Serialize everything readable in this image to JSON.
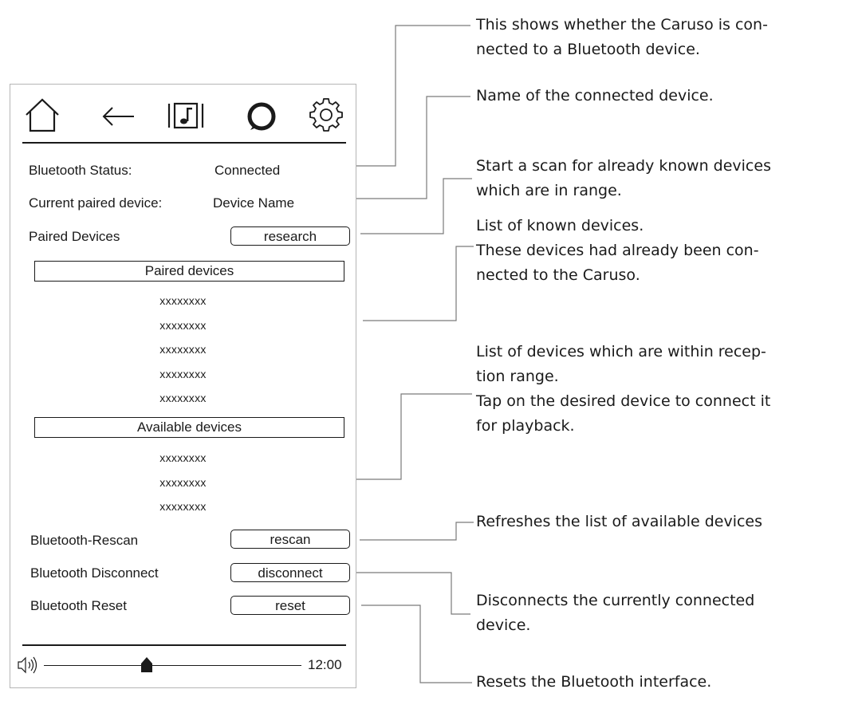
{
  "toolbar": {
    "icons": [
      "home-icon",
      "back-arrow-icon",
      "music-library-icon",
      "alexa-ring-icon",
      "gear-icon"
    ]
  },
  "status": {
    "bluetooth_status_label": "Bluetooth Status:",
    "bluetooth_status_value": "Connected",
    "paired_device_label": "Current paired device:",
    "paired_device_value": "Device Name",
    "paired_devices_label": "Paired Devices",
    "research_button": "research"
  },
  "paired_section": {
    "title": "Paired devices",
    "items": [
      "xxxxxxxx",
      "xxxxxxxx",
      "xxxxxxxx",
      "xxxxxxxx",
      "xxxxxxxx"
    ]
  },
  "available_section": {
    "title": "Available devices",
    "items": [
      "xxxxxxxx",
      "xxxxxxxx",
      "xxxxxxxx"
    ]
  },
  "actions": {
    "rescan_label": "Bluetooth-Rescan",
    "rescan_button": "rescan",
    "disconnect_label": "Bluetooth Disconnect",
    "disconnect_button": "disconnect",
    "reset_label": "Bluetooth Reset",
    "reset_button": "reset"
  },
  "footer": {
    "volume_icon": "speaker-volume-icon",
    "volume_level": 0.4,
    "clock": "12:00"
  },
  "annotations": [
    "This shows whether the Caruso is con-\nnected to a Bluetooth device.",
    "Name of the connected device.",
    "Start a scan for already known devices\nwhich are in range.",
    "List of known devices.\nThese devices had already been con-\nnected to the Caruso.",
    "List of devices which are within recep-\ntion range.\nTap on the desired device to connect it\nfor playback.",
    "Refreshes the list of available devices",
    "Disconnects the currently connected\ndevice.",
    "Resets the Bluetooth interface."
  ]
}
